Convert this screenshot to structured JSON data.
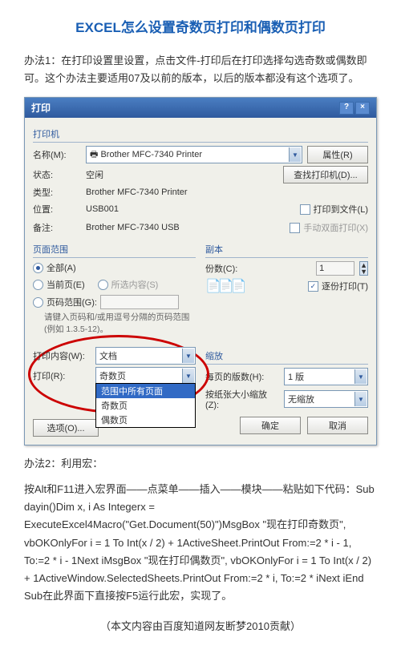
{
  "title": "EXCEL怎么设置奇数页打印和偶数页打印",
  "method1_label": "办法1",
  "method1_text": "：在打印设置里设置，点击文件-打印后在打印选择勾选奇数或偶数即可。这个办法主要适用07及以前的版本，以后的版本都没有这个选项了。",
  "dialog": {
    "title": "打印",
    "help_icon": "?",
    "close_icon": "×",
    "printer_section": "打印机",
    "name_label": "名称(M):",
    "printer_name": "Brother MFC-7340 Printer",
    "properties_btn": "属性(R)",
    "status_label": "状态:",
    "status_value": "空闲",
    "find_printer_btn": "查找打印机(D)...",
    "type_label": "类型:",
    "type_value": "Brother MFC-7340 Printer",
    "where_label": "位置:",
    "where_value": "USB001",
    "print_to_file": "打印到文件(L)",
    "comment_label": "备注:",
    "comment_value": "Brother MFC-7340 USB",
    "manual_duplex": "手动双面打印(X)",
    "range_section": "页面范围",
    "range_all": "全部(A)",
    "range_current": "当前页(E)",
    "range_selection": "所选内容(S)",
    "range_pages": "页码范围(G):",
    "range_hint": "请键入页码和/或用逗号分隔的页码范围(例如 1.3.5-12)。",
    "copies_section": "副本",
    "copies_label": "份数(C):",
    "copies_value": "1",
    "collate": "逐份打印(T)",
    "content_label": "打印内容(W):",
    "content_value": "文档",
    "print_label": "打印(R):",
    "print_value": "奇数页",
    "dropdown_opts": {
      "opt1": "范围中所有页面",
      "opt2": "奇数页",
      "opt3": "偶数页"
    },
    "options_btn": "选项(O)...",
    "zoom_section": "缩放",
    "pages_per_sheet_label": "每页的版数(H):",
    "pages_per_sheet_value": "1 版",
    "scale_label": "按纸张大小缩放(Z):",
    "scale_value": "无缩放",
    "ok_btn": "确定",
    "cancel_btn": "取消"
  },
  "method2_label": "办法2：利用宏：",
  "method2_text": "按Alt和F11进入宏界面——点菜单——插入——模块——粘贴如下代码：Sub dayin()Dim x, i As Integerx = ExecuteExcel4Macro(\"Get.Document(50)\")MsgBox \"现在打印奇数页\", vbOKOnlyFor i = 1 To Int(x / 2) + 1ActiveSheet.PrintOut From:=2 * i - 1, To:=2 * i - 1Next iMsgBox \"现在打印偶数页\", vbOKOnlyFor i = 1 To Int(x / 2) + 1ActiveWindow.SelectedSheets.PrintOut From:=2 * i, To:=2 * iNext iEnd Sub在此界面下直接按F5运行此宏，实现了。",
  "attribution": "（本文内容由百度知道网友断梦2010贡献）"
}
